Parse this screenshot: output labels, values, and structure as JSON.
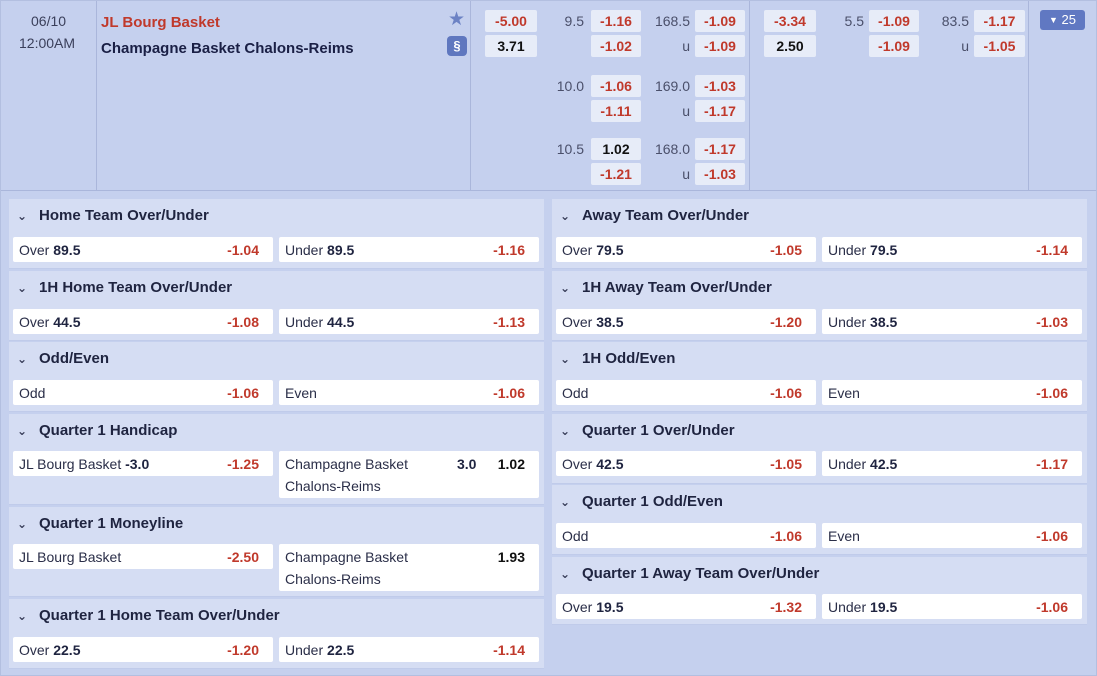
{
  "match": {
    "date": "06/10",
    "time": "12:00AM",
    "home": "JL Bourg Basket",
    "away": "Champagne Basket Chalons-Reims",
    "more_count": "25",
    "ft_handicap": {
      "home": "-5.00",
      "away": "3.71"
    },
    "ft_lines": [
      {
        "hdp": "9.5",
        "hdp_home": "-1.16",
        "hdp_away": "-1.02",
        "total": "168.5",
        "over": "-1.09",
        "under_label": "u",
        "under": "-1.09"
      },
      {
        "hdp": "10.0",
        "hdp_home": "-1.06",
        "hdp_away": "-1.11",
        "total": "169.0",
        "over": "-1.03",
        "under_label": "u",
        "under": "-1.17"
      },
      {
        "hdp": "10.5",
        "hdp_home": "1.02",
        "hdp_away": "-1.21",
        "total": "168.0",
        "over": "-1.17",
        "under_label": "u",
        "under": "-1.03"
      }
    ],
    "h1": {
      "home": "-3.34",
      "away": "2.50",
      "hdp": "5.5",
      "hdp_home": "-1.09",
      "hdp_away": "-1.09",
      "total": "83.5",
      "over": "-1.17",
      "under_label": "u",
      "under": "-1.05"
    }
  },
  "markets_left": [
    {
      "title": "Home Team Over/Under",
      "a": {
        "label": "Over",
        "line": "89.5",
        "odds": "-1.04"
      },
      "b": {
        "label": "Under",
        "line": "89.5",
        "odds": "-1.16"
      }
    },
    {
      "title": "1H Home Team Over/Under",
      "a": {
        "label": "Over",
        "line": "44.5",
        "odds": "-1.08"
      },
      "b": {
        "label": "Under",
        "line": "44.5",
        "odds": "-1.13"
      }
    },
    {
      "title": "Odd/Even",
      "a": {
        "label": "Odd",
        "line": "",
        "odds": "-1.06"
      },
      "b": {
        "label": "Even",
        "line": "",
        "odds": "-1.06"
      }
    },
    {
      "title": "Quarter 1 Handicap",
      "a": {
        "label": "JL Bourg Basket",
        "line": "-3.0",
        "odds": "-1.25"
      },
      "b": {
        "label": "Champagne Basket Chalons-Reims",
        "line": "3.0",
        "odds": "1.02"
      }
    },
    {
      "title": "Quarter 1 Moneyline",
      "a": {
        "label": "JL Bourg Basket",
        "line": "",
        "odds": "-2.50"
      },
      "b": {
        "label": "Champagne Basket Chalons-Reims",
        "line": "",
        "odds": "1.93"
      }
    },
    {
      "title": "Quarter 1 Home Team Over/Under",
      "a": {
        "label": "Over",
        "line": "22.5",
        "odds": "-1.20"
      },
      "b": {
        "label": "Under",
        "line": "22.5",
        "odds": "-1.14"
      }
    }
  ],
  "markets_right": [
    {
      "title": "Away Team Over/Under",
      "a": {
        "label": "Over",
        "line": "79.5",
        "odds": "-1.05"
      },
      "b": {
        "label": "Under",
        "line": "79.5",
        "odds": "-1.14"
      }
    },
    {
      "title": "1H Away Team Over/Under",
      "a": {
        "label": "Over",
        "line": "38.5",
        "odds": "-1.20"
      },
      "b": {
        "label": "Under",
        "line": "38.5",
        "odds": "-1.03"
      }
    },
    {
      "title": "1H Odd/Even",
      "a": {
        "label": "Odd",
        "line": "",
        "odds": "-1.06"
      },
      "b": {
        "label": "Even",
        "line": "",
        "odds": "-1.06"
      }
    },
    {
      "title": "Quarter 1 Over/Under",
      "a": {
        "label": "Over",
        "line": "42.5",
        "odds": "-1.05"
      },
      "b": {
        "label": "Under",
        "line": "42.5",
        "odds": "-1.17"
      }
    },
    {
      "title": "Quarter 1 Odd/Even",
      "a": {
        "label": "Odd",
        "line": "",
        "odds": "-1.06"
      },
      "b": {
        "label": "Even",
        "line": "",
        "odds": "-1.06"
      }
    },
    {
      "title": "Quarter 1 Away Team Over/Under",
      "a": {
        "label": "Over",
        "line": "19.5",
        "odds": "-1.32"
      },
      "b": {
        "label": "Under",
        "line": "19.5",
        "odds": "-1.06"
      }
    }
  ],
  "colors": {
    "negative": "#c0392b",
    "positive": "#111111",
    "accent": "#6078c2",
    "panel": "#d5ddf3"
  },
  "icons": {
    "favorite": "star-icon",
    "stats": "stats-icon",
    "expand": "chevron-down-icon"
  }
}
